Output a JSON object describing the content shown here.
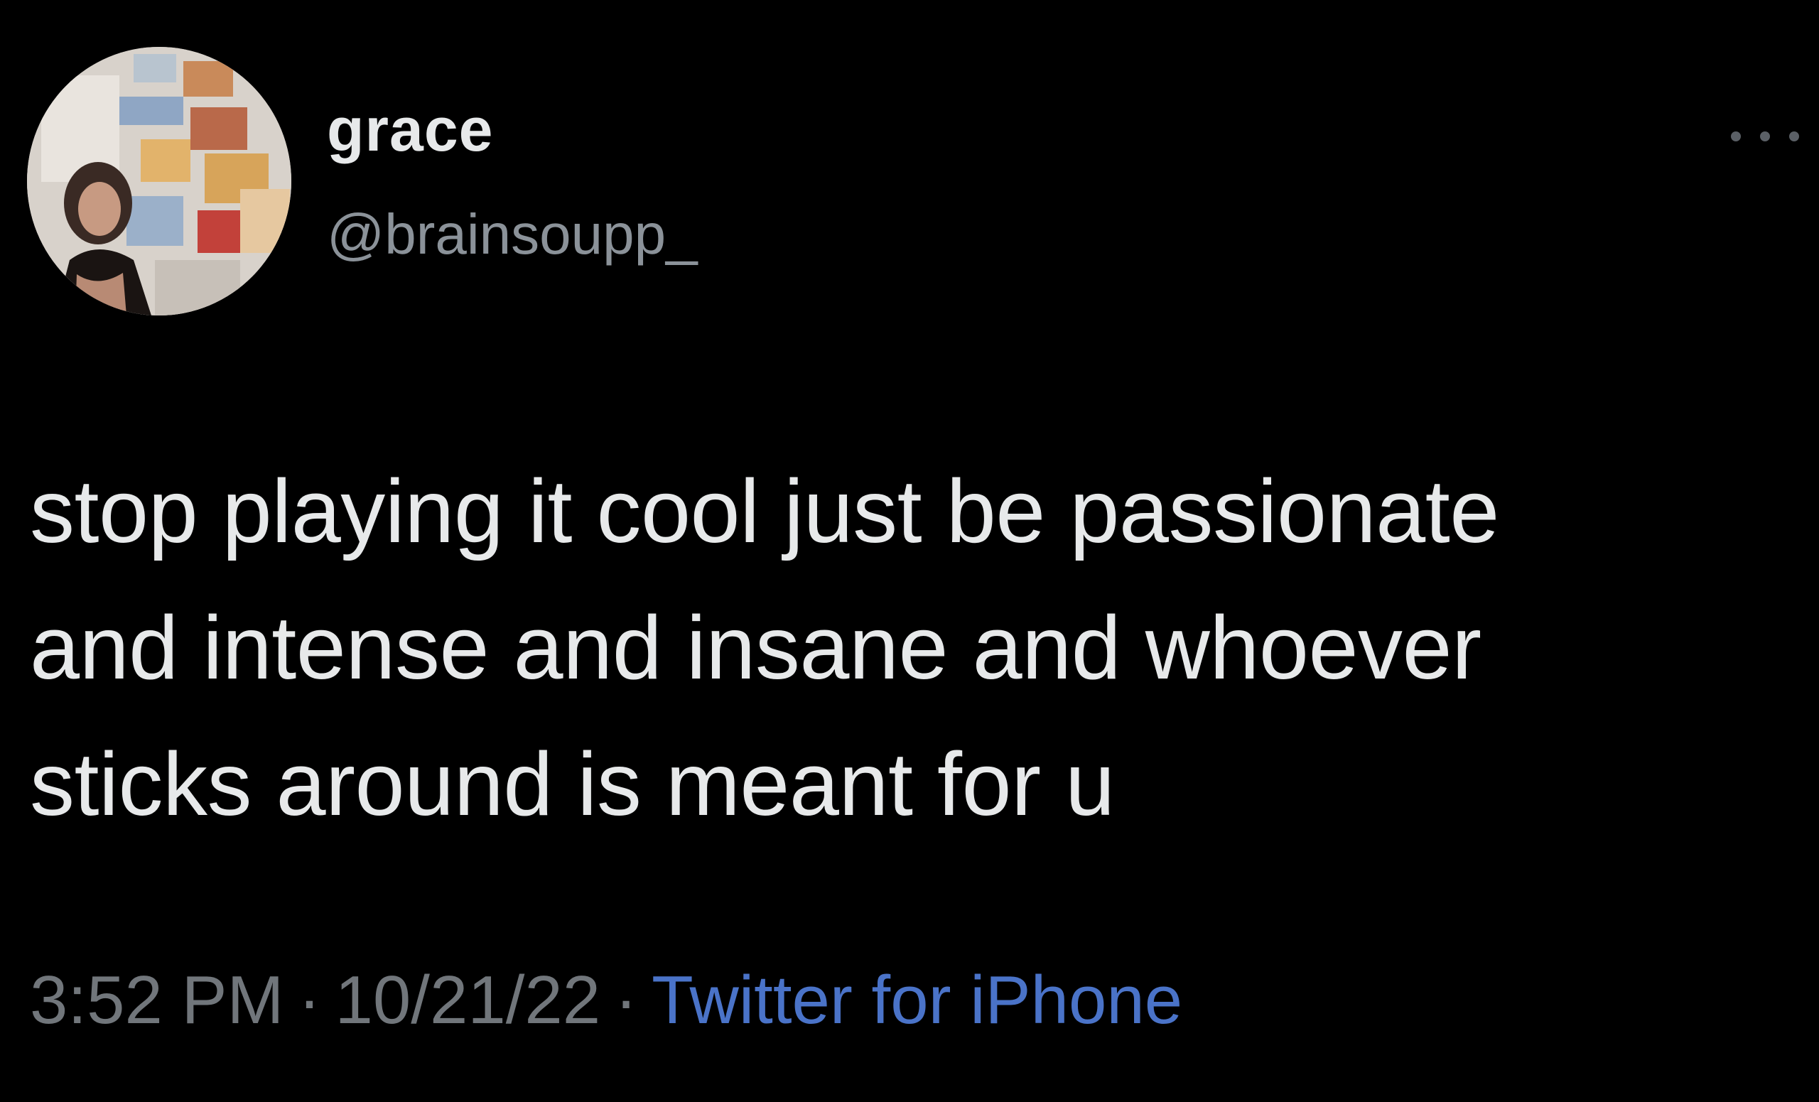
{
  "author": {
    "display_name": "grace",
    "handle": "@brainsoupp_"
  },
  "icons": {
    "more": "more-horizontal-icon"
  },
  "tweet": {
    "text_lines": [
      "stop playing it cool just be passionate",
      "and intense and insane and whoever",
      "sticks around is meant for u"
    ]
  },
  "meta": {
    "time": "3:52 PM",
    "date": "10/21/22",
    "separator": "·",
    "source": "Twitter for iPhone"
  },
  "colors": {
    "background": "#000000",
    "text": "#e7e9ea",
    "secondary": "#71767b",
    "link": "#4a73c8"
  }
}
